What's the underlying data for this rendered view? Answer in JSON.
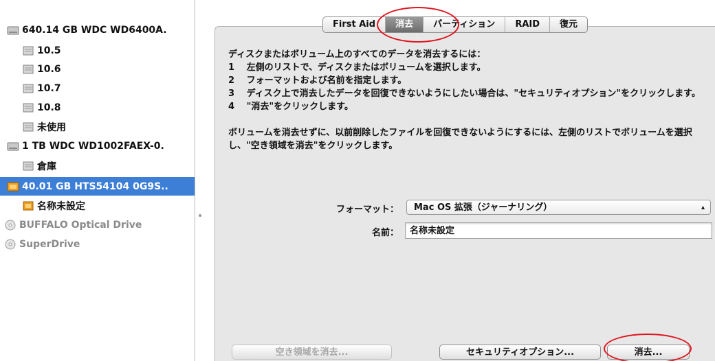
{
  "sidebar": {
    "items": [
      {
        "label": "640.14 GB WDC WD6400A.",
        "icon": "hard-disk-icon"
      },
      {
        "label": "10.5",
        "icon": "volume-icon"
      },
      {
        "label": "10.6",
        "icon": "volume-icon"
      },
      {
        "label": "10.7",
        "icon": "volume-icon"
      },
      {
        "label": "10.8",
        "icon": "volume-icon"
      },
      {
        "label": "未使用",
        "icon": "volume-icon"
      },
      {
        "label": "1 TB WDC WD1002FAEX-0.",
        "icon": "hard-disk-icon"
      },
      {
        "label": "倉庫",
        "icon": "volume-icon"
      },
      {
        "label": "40.01 GB HTS54104 0G9S..",
        "icon": "external-disk-icon",
        "selected": true
      },
      {
        "label": "名称未設定",
        "icon": "external-volume-icon"
      },
      {
        "label": "BUFFALO Optical Drive",
        "icon": "optical-drive-icon",
        "dimmed": true
      },
      {
        "label": "SuperDrive",
        "icon": "optical-drive-icon",
        "dimmed": true
      }
    ]
  },
  "tabs": [
    {
      "label": "First Aid",
      "active": false
    },
    {
      "label": "消去",
      "active": true
    },
    {
      "label": "パーティション",
      "active": false
    },
    {
      "label": "RAID",
      "active": false
    },
    {
      "label": "復元",
      "active": false
    }
  ],
  "instructions": {
    "lines": [
      "ディスクまたはボリューム上のすべてのデータを消去するには：",
      "1　 左側のリストで、ディスクまたはボリュームを選択します。",
      "2　 フォーマットおよび名前を指定します。",
      "3　 ディスク上で消去したデータを回復できないようにしたい場合は、\"セキュリティオプション\"をクリックします。",
      "4　 \"消去\"をクリックします。"
    ],
    "paragraph": "ボリュームを消去せずに、以前削除したファイルを回復できないようにするには、左側のリストでボリュームを選択し、\"空き領域を消去\"をクリックします。"
  },
  "form": {
    "format_label": "フォーマット：",
    "format_value": "Mac OS 拡張（ジャーナリング）",
    "name_label": "名前：",
    "name_value": "名称未設定"
  },
  "buttons": {
    "erase_free_space": "空き領域を消去...",
    "security_options": "セキュリティオプション...",
    "erase": "消去..."
  },
  "colors": {
    "selection": "#3d7fd6",
    "highlight_circle": "#e0141e"
  }
}
